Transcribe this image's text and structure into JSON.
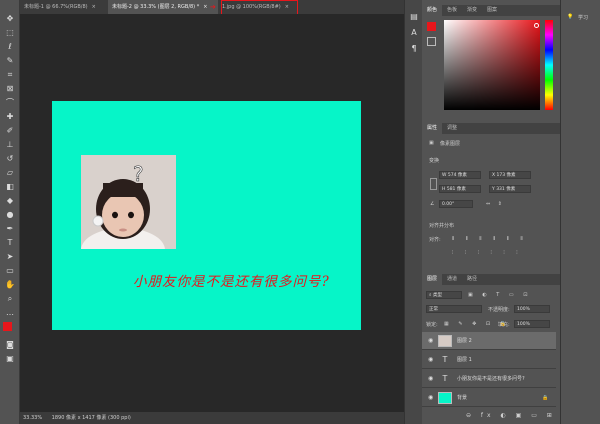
{
  "tabs": [
    {
      "label": "未标题-1 @ 66.7%(RGB/8)",
      "close": "×"
    },
    {
      "label": "未标题-2 @ 33.3% (图层 2, RGB/8) *",
      "close": "×"
    },
    {
      "label": "1.jpg @ 100%(RGB/8#)",
      "close": "×"
    }
  ],
  "canvas": {
    "text": "小朋友你是不是还有很多问号?",
    "question_mark": "?"
  },
  "status": {
    "zoom": "33.33%",
    "doc": "1890 像素 x 1417 像素 (300 ppi)"
  },
  "color_panel": {
    "tabs": [
      "颜色",
      "色板",
      "渐变",
      "图案"
    ]
  },
  "learn": {
    "label": "学习"
  },
  "properties": {
    "tabs": [
      "属性",
      "调整"
    ],
    "kind": "像素图层",
    "transform_heading": "变换",
    "w_label": "W",
    "w_value": "574 像素",
    "x_label": "X",
    "x_value": "173 像素",
    "h_label": "H",
    "h_value": "581 像素",
    "y_label": "Y",
    "y_value": "331 像素",
    "angle_value": "0.00°",
    "align_heading": "对齐并分布",
    "align_label": "对齐:"
  },
  "layers_panel": {
    "tabs": [
      "图层",
      "通道",
      "路径"
    ],
    "filter": "类型",
    "blend": "正常",
    "opacity_label": "不透明度:",
    "opacity_value": "100%",
    "lock_label": "锁定:",
    "fill_label": "填充:",
    "fill_value": "100%",
    "layers": [
      {
        "name": "图层 2",
        "type": "pixel"
      },
      {
        "name": "图层 1",
        "type": "text",
        "glyph": "T"
      },
      {
        "name": "小朋友你是不是还有很多问号?",
        "type": "text",
        "glyph": "T"
      },
      {
        "name": "背景",
        "type": "background"
      }
    ]
  },
  "colors": {
    "foreground": "#e8161b",
    "background": "#ffffff",
    "canvas": "#06f5c8",
    "highlight_box": "#e8161b"
  }
}
